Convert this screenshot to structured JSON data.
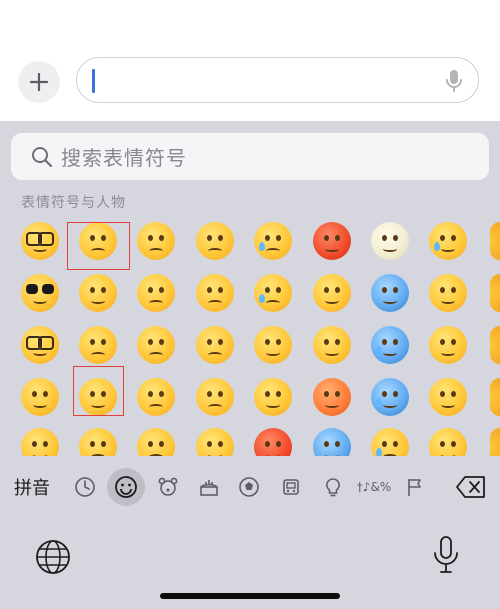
{
  "composer": {
    "add_icon": "plus-icon",
    "message_value": "",
    "mic_icon": "microphone-icon"
  },
  "emoji_keyboard": {
    "search_placeholder": "搜索表情符号",
    "section_label": "表情符号与人物",
    "highlighted": [
      "weary-face-in-row1",
      "relieved-face-in-row4"
    ],
    "toolbar": {
      "pinyin_label": "拼音",
      "categories": [
        "recent-icon",
        "smileys-icon",
        "animals-icon",
        "food-icon",
        "activity-icon",
        "travel-icon",
        "objects-icon",
        "symbols-icon",
        "flags-icon"
      ],
      "symbols_label": "†♪&%"
    },
    "bottom": {
      "globe_icon": "globe-icon",
      "mic_icon": "microphone-icon"
    },
    "colors": {
      "accent": "#3a73d6",
      "highlight_box": "#e0403a",
      "keyboard_bg": "#d6d7de"
    }
  }
}
